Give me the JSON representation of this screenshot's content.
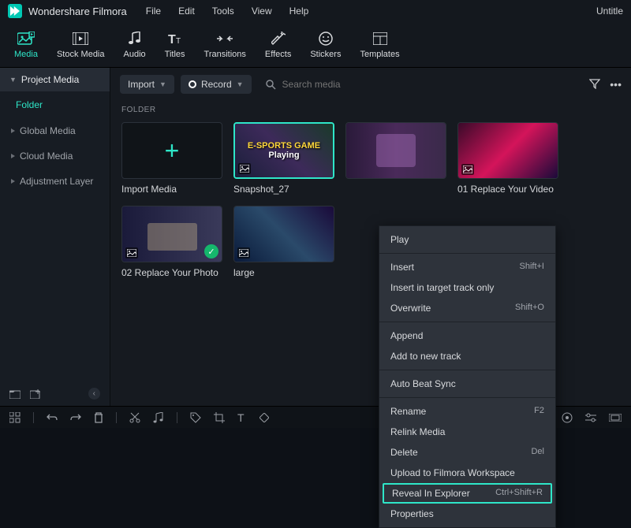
{
  "app": {
    "name": "Wondershare Filmora",
    "document": "Untitle"
  },
  "menus": [
    "File",
    "Edit",
    "Tools",
    "View",
    "Help"
  ],
  "ribbon": [
    {
      "label": "Media",
      "icon": "media-icon",
      "active": true
    },
    {
      "label": "Stock Media",
      "icon": "film-icon"
    },
    {
      "label": "Audio",
      "icon": "note-icon"
    },
    {
      "label": "Titles",
      "icon": "titles-icon"
    },
    {
      "label": "Transitions",
      "icon": "transitions-icon"
    },
    {
      "label": "Effects",
      "icon": "effects-icon"
    },
    {
      "label": "Stickers",
      "icon": "stickers-icon"
    },
    {
      "label": "Templates",
      "icon": "templates-icon"
    }
  ],
  "sidebar": {
    "header": "Project Media",
    "folder": "Folder",
    "items": [
      "Global Media",
      "Cloud Media",
      "Adjustment Layer"
    ]
  },
  "toolbar": {
    "import": "Import",
    "record": "Record",
    "search_placeholder": "Search media"
  },
  "section_label": "FOLDER",
  "cards": [
    {
      "label": "Import Media",
      "type": "add"
    },
    {
      "label": "Snapshot_27",
      "type": "img",
      "overlay": "E-SPORTS GAME",
      "overlay2": "Playing",
      "selected": true
    },
    {
      "label": "",
      "type": "img2"
    },
    {
      "label": "01 Replace Your Video",
      "type": "img3"
    },
    {
      "label": "02 Replace Your Photo",
      "type": "img4",
      "checked": true
    },
    {
      "label": "large",
      "type": "img5"
    }
  ],
  "context_menu": [
    {
      "label": "Play"
    },
    {
      "sep": true
    },
    {
      "label": "Insert",
      "shortcut": "Shift+I"
    },
    {
      "label": "Insert in target track only"
    },
    {
      "label": "Overwrite",
      "shortcut": "Shift+O"
    },
    {
      "sep": true
    },
    {
      "label": "Append"
    },
    {
      "label": "Add to new track"
    },
    {
      "sep": true
    },
    {
      "label": "Auto Beat Sync"
    },
    {
      "sep": true
    },
    {
      "label": "Rename",
      "shortcut": "F2"
    },
    {
      "label": "Relink Media"
    },
    {
      "label": "Delete",
      "shortcut": "Del"
    },
    {
      "label": "Upload to Filmora Workspace"
    },
    {
      "label": "Reveal In Explorer",
      "shortcut": "Ctrl+Shift+R",
      "highlight": true
    },
    {
      "label": "Properties"
    }
  ]
}
